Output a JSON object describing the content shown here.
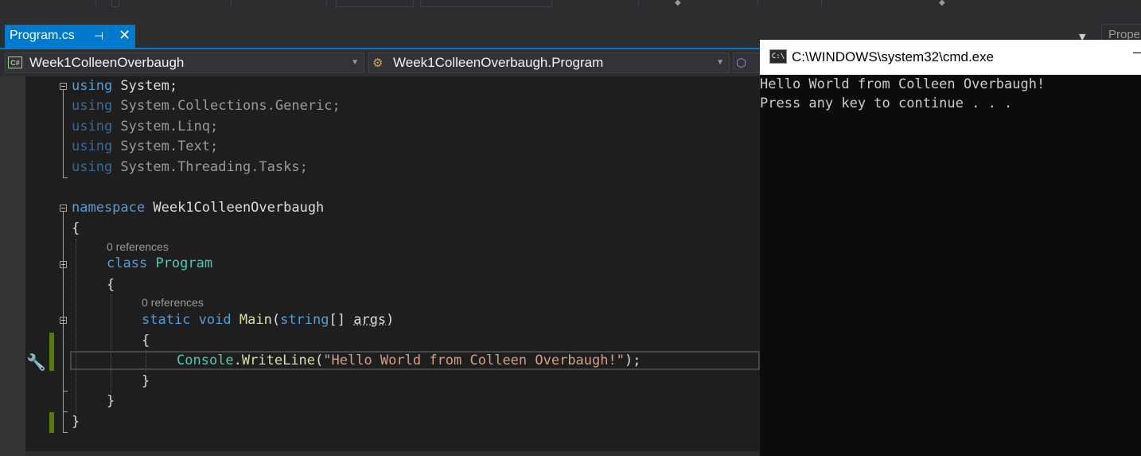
{
  "tab": {
    "title": "Program.cs",
    "pin_icon": "⊣",
    "close_icon": "✕"
  },
  "properties_tab": {
    "label": "Prope"
  },
  "navbar": {
    "project": "Week1ColleenOverbaugh",
    "project_icon_text": "C#",
    "class": "Week1ColleenOverbaugh.Program",
    "member": ""
  },
  "editor": {
    "lines": {
      "using_system": {
        "kw": "using",
        "rest": " System;"
      },
      "using_collections": {
        "kw": "using",
        "rest": " System.Collections.Generic;"
      },
      "using_linq": {
        "kw": "using",
        "rest": " System.Linq;"
      },
      "using_text": {
        "kw": "using",
        "rest": " System.Text;"
      },
      "using_threading": {
        "kw": "using",
        "rest": " System.Threading.Tasks;"
      },
      "namespace": {
        "kw": "namespace",
        "name": " Week1ColleenOverbaugh"
      },
      "brace_open_ns": "{",
      "class_refs": "0 references",
      "class_decl": {
        "kw": "class",
        "name": "Program"
      },
      "brace_open_class": "{",
      "main_refs": "0 references",
      "main_decl": {
        "kw1": "static",
        "kw2": "void",
        "fn": "Main",
        "paren": "(",
        "kw3": "string",
        "brackets": "[] ",
        "param": "args",
        "close": ")"
      },
      "brace_open_main": "{",
      "console": {
        "type": "Console",
        "dot": ".",
        "fn": "WriteLine",
        "open": "(",
        "str": "\"Hello World from Colleen Overbaugh!\"",
        "close": ");"
      },
      "brace_close_main": "}",
      "brace_close_class": "}",
      "brace_close_ns": "}"
    }
  },
  "cmd": {
    "title": "C:\\WINDOWS\\system32\\cmd.exe",
    "icon_text": "C:\\",
    "minimize": "—",
    "output": [
      "Hello World from Colleen Overbaugh!",
      "Press any key to continue . . ."
    ]
  },
  "colors": {
    "accent": "#007acc",
    "keyword": "#569cd6",
    "type": "#4ec9b0",
    "method": "#dcdcaa",
    "string": "#d69d85",
    "change_bar": "#587c0c"
  }
}
